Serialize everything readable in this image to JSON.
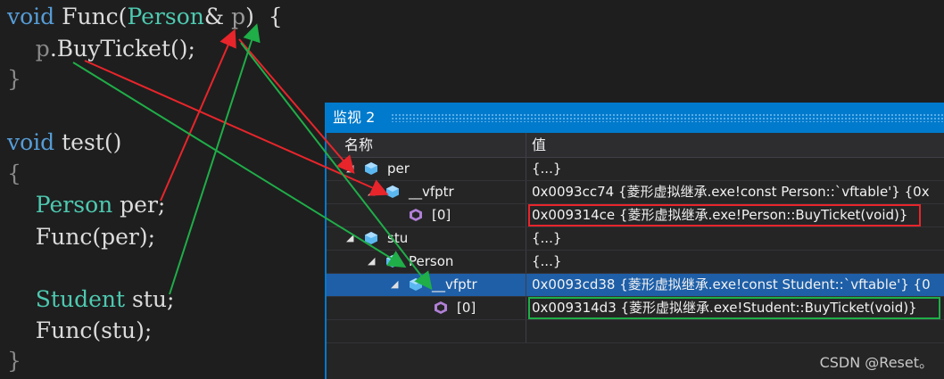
{
  "code": {
    "line1": {
      "kw": "void",
      "fn": " Func(",
      "ty": "Person",
      "rest": "& ",
      "param": "p",
      "close": ")  {"
    },
    "line2": {
      "indent": "    ",
      "obj": "p",
      "call": ".BuyTicket();"
    },
    "line3": "}",
    "line5": {
      "kw": "void",
      "rest": " test()"
    },
    "line6": "{",
    "line7": {
      "indent": "    ",
      "ty": "Person",
      "rest": " per;"
    },
    "line8": {
      "indent": "    ",
      "rest": "Func(per);"
    },
    "line10": {
      "indent": "    ",
      "ty": "Student",
      "rest": " stu;"
    },
    "line11": {
      "indent": "    ",
      "rest": "Func(stu);"
    },
    "line12": "}"
  },
  "watch": {
    "title": "监视 2",
    "col_name": "名称",
    "col_value": "值",
    "rows": [
      {
        "name": "per",
        "value": "{...}"
      },
      {
        "name": "__vfptr",
        "value": "0x0093cc74 {菱形虚拟继承.exe!const Person::`vftable'} {0x"
      },
      {
        "name": "[0]",
        "value": "0x009314ce {菱形虚拟继承.exe!Person::BuyTicket(void)}"
      },
      {
        "name": "stu",
        "value": "{...}"
      },
      {
        "name": "Person",
        "value": "{...}"
      },
      {
        "name": "__vfptr",
        "value": "0x0093cd38 {菱形虚拟继承.exe!const Student::`vftable'} {0"
      },
      {
        "name": "[0]",
        "value": "0x009314d3 {菱形虚拟继承.exe!Student::BuyTicket(void)}"
      }
    ]
  },
  "watermark": "CSDN @Reset。",
  "colors": {
    "keyword": "#569cd6",
    "type": "#4ec9b0",
    "accent": "#007acc",
    "arrow_red": "#e8252b",
    "arrow_green": "#1fae48",
    "selected_row": "#1e5fa8"
  }
}
